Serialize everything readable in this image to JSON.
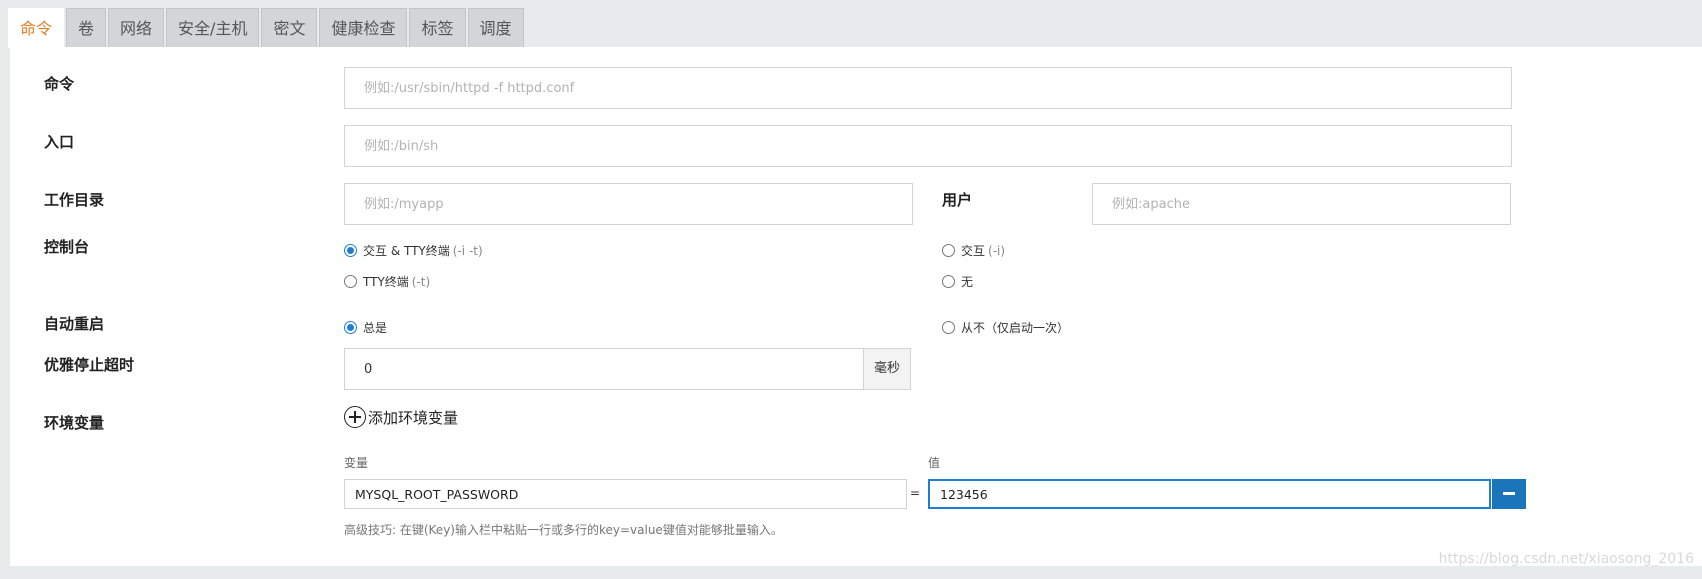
{
  "tabs": [
    {
      "label": "命令",
      "active": true
    },
    {
      "label": "卷"
    },
    {
      "label": "网络"
    },
    {
      "label": "安全/主机"
    },
    {
      "label": "密文"
    },
    {
      "label": "健康检查"
    },
    {
      "label": "标签"
    },
    {
      "label": "调度"
    }
  ],
  "form": {
    "command": {
      "label": "命令",
      "placeholder": "例如:/usr/sbin/httpd -f httpd.conf",
      "value": ""
    },
    "entrypoint": {
      "label": "入口",
      "placeholder": "例如:/bin/sh",
      "value": ""
    },
    "workdir": {
      "label": "工作目录",
      "placeholder": "例如:/myapp",
      "value": ""
    },
    "user": {
      "label": "用户",
      "placeholder": "例如:apache",
      "value": ""
    },
    "console": {
      "label": "控制台",
      "options": [
        {
          "label": "交互 & TTY终端",
          "hint": "(-i -t)",
          "selected": true
        },
        {
          "label": "交互",
          "hint": "(-i)",
          "selected": false
        },
        {
          "label": "TTY终端",
          "hint": "(-t)",
          "selected": false
        },
        {
          "label": "无",
          "hint": "",
          "selected": false
        }
      ]
    },
    "restart": {
      "label": "自动重启",
      "options": [
        {
          "label": "总是",
          "selected": true
        },
        {
          "label": "从不（仅启动一次）",
          "selected": false
        }
      ]
    },
    "stop_timeout": {
      "label": "优雅停止超时",
      "value": "0",
      "unit": "毫秒"
    },
    "env": {
      "label": "环境变量",
      "add_label": "添加环境变量",
      "key_header": "变量",
      "value_header": "值",
      "equals": "=",
      "rows": [
        {
          "key": "MYSQL_ROOT_PASSWORD",
          "value": "123456"
        }
      ],
      "tip": "高级技巧: 在键(Key)输入栏中粘贴一行或多行的key=value键值对能够批量输入。"
    }
  },
  "watermark": "https://blog.csdn.net/xiaosong_2016",
  "colors": {
    "accent": "#e67e22",
    "primary": "#1b75bb",
    "radio": "#1e7fd2"
  }
}
